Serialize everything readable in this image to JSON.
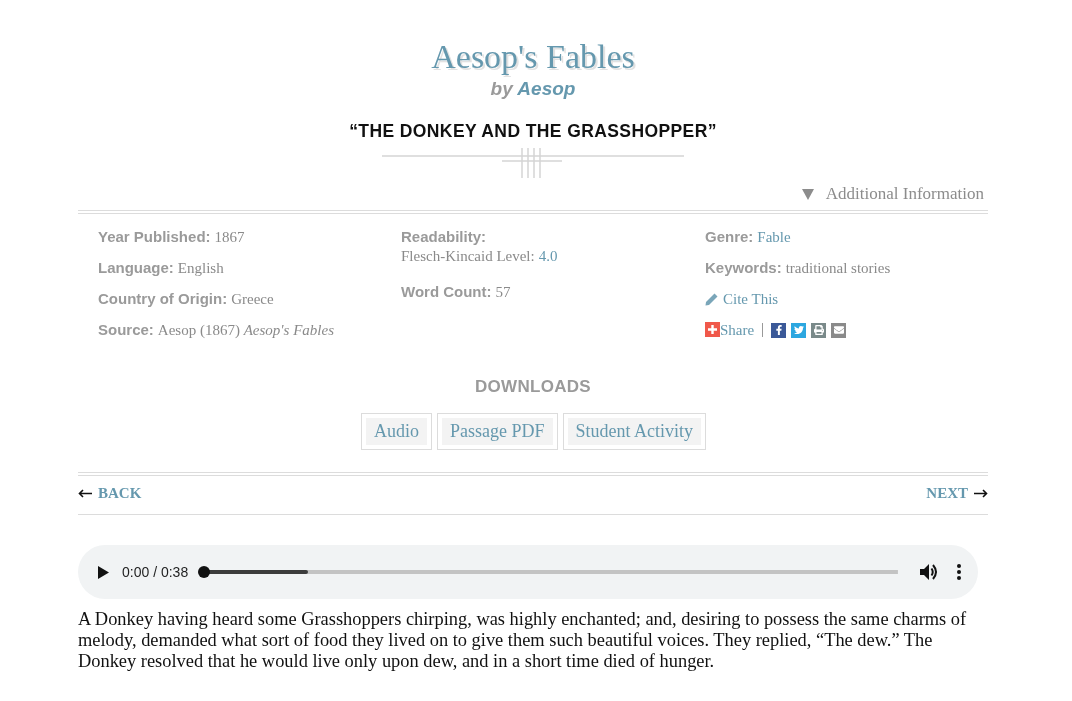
{
  "header": {
    "title": "Aesop's Fables",
    "byline_prefix": "by",
    "author": "Aesop",
    "story_title": "“THE DONKEY AND THE GRASSHOPPER”"
  },
  "additional_info": {
    "label": "Additional Information",
    "expanded": true,
    "columns": [
      [
        {
          "kind": "field",
          "label": "Year Published:",
          "value": "1867",
          "linked": false
        },
        {
          "kind": "field",
          "label": "Language:",
          "value": "English",
          "linked": false
        },
        {
          "kind": "field",
          "label": "Country of Origin:",
          "value": "Greece",
          "linked": false
        },
        {
          "kind": "field",
          "label": "Source:",
          "value": "Aesop (1867) *Aesop's Fables*",
          "linked": false
        }
      ],
      [
        {
          "kind": "stacked",
          "label": "Readability:",
          "value_label": "Flesch-Kincaid Level:",
          "value": "4.0",
          "linked": true
        },
        {
          "kind": "field",
          "label": "Word Count:",
          "value": "57",
          "linked": false
        }
      ],
      [
        {
          "kind": "field",
          "label": "Genre:",
          "value": "Fable",
          "linked": true
        },
        {
          "kind": "field",
          "label": "Keywords:",
          "value": "traditional stories",
          "linked": false
        },
        {
          "kind": "cite",
          "label": "Cite This"
        },
        {
          "kind": "share",
          "label": "Share"
        }
      ]
    ]
  },
  "downloads": {
    "heading": "DOWNLOADS",
    "buttons": [
      "Audio",
      "Passage PDF",
      "Student Activity"
    ]
  },
  "navigation": {
    "back": "BACK",
    "next": "NEXT"
  },
  "audio_player": {
    "time": "0:00 / 0:38",
    "progress": {
      "level": 0
    },
    "buffer": {
      "level": 0.15
    }
  },
  "passage": "A Donkey having heard some Grasshoppers chirping, was highly enchanted; and, desiring to possess the same charms of melody, demanded what sort of food they lived on to give them such beautiful voices. They replied, “The dew.” The Donkey resolved that he would live only upon dew, and in a short time died of hunger."
}
